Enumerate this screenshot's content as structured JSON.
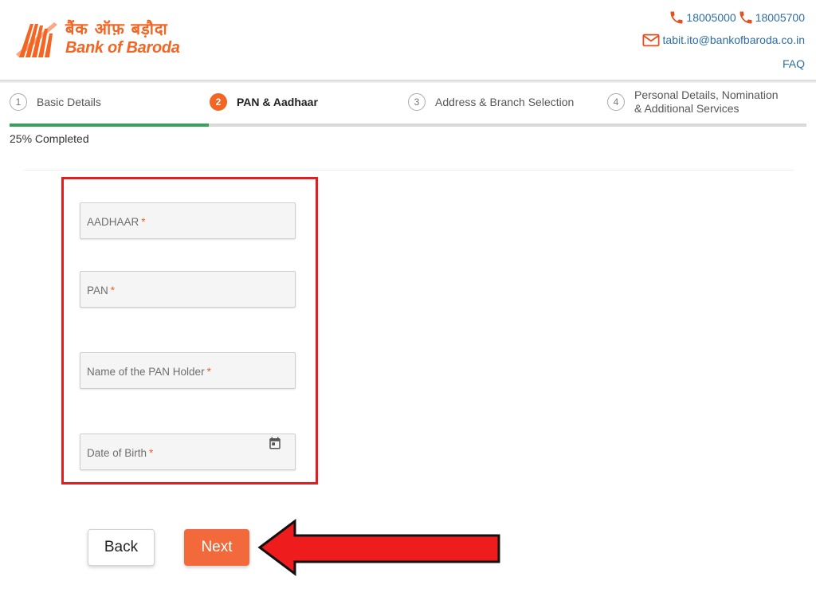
{
  "brand": {
    "name_hindi": "बैंक ऑफ़ बड़ौदा",
    "name_english": "Bank of Baroda",
    "logo_icon": "baroda-sun-icon",
    "color": "#f26522"
  },
  "contact": {
    "phone_1": "18005000",
    "phone_2": "18005700",
    "email": "tabit.ito@bankofbaroda.co.in",
    "faq_label": "FAQ",
    "icons": [
      "phone-icon",
      "mail-icon"
    ],
    "color": "#2d6ea3"
  },
  "stepper": {
    "steps": [
      {
        "number": "1",
        "label": "Basic Details",
        "state": "inactive"
      },
      {
        "number": "2",
        "label": "PAN & Aadhaar",
        "state": "active"
      },
      {
        "number": "3",
        "label": "Address & Branch Selection",
        "state": "inactive"
      },
      {
        "number": "4",
        "label_line1": "Personal Details, Nomination",
        "label_line2": "& Additional Services",
        "state": "inactive"
      }
    ],
    "progress_percent": 25,
    "progress_text": "25% Completed",
    "progress_color": "#3aa15a"
  },
  "form": {
    "fields": [
      {
        "label": "AADHAAR",
        "required_mark": "*",
        "value": ""
      },
      {
        "label": "PAN",
        "required_mark": "*",
        "value": ""
      },
      {
        "label": "Name of the PAN Holder",
        "required_mark": "*",
        "value": ""
      },
      {
        "label": "Date of Birth",
        "required_mark": "*",
        "value": "",
        "icon": "calendar-icon"
      }
    ],
    "highlight_color": "#e11d1d"
  },
  "buttons": {
    "back_label": "Back",
    "next_label": "Next",
    "next_color": "#f26a3b"
  },
  "annotation": {
    "arrow_color": "#ee1c1c"
  }
}
